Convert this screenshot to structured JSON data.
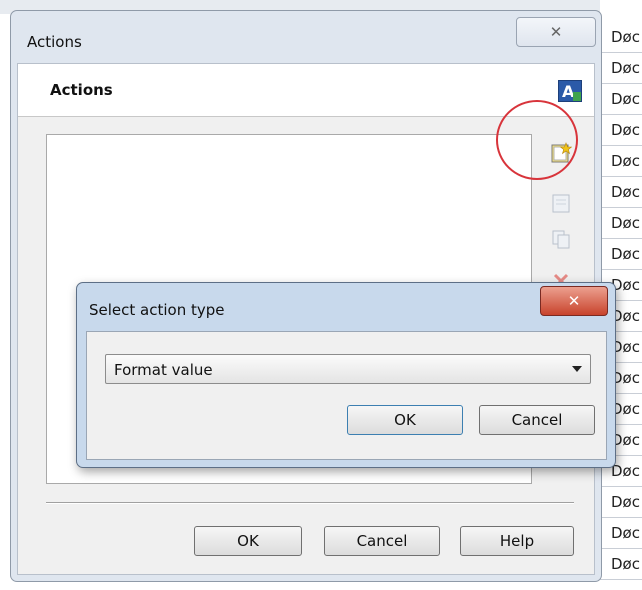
{
  "background_sheet": {
    "cells": [
      "Døc",
      "Døc",
      "Døc",
      "Døc",
      "Døc",
      "Døc",
      "Døc",
      "Døc",
      "Døc",
      "Døc",
      "Døc",
      "Døc",
      "Døc",
      "Døc",
      "Døc",
      "Døc",
      "Døc",
      "Døc"
    ]
  },
  "actions_window": {
    "title": "Actions",
    "close_glyph": "✕",
    "section_title": "Actions",
    "buttons": {
      "ok": "OK",
      "cancel": "Cancel",
      "help": "Help"
    },
    "side_buttons": [
      {
        "icon": "new-action-icon"
      },
      {
        "icon": "edit-action-icon"
      },
      {
        "icon": "copy-action-icon"
      },
      {
        "icon": "delete-action-icon"
      }
    ],
    "highlight_color": "#d8343b"
  },
  "select_dialog": {
    "title": "Select action type",
    "close_glyph": "✕",
    "selected_type": "Format value",
    "buttons": {
      "ok": "OK",
      "cancel": "Cancel"
    }
  }
}
